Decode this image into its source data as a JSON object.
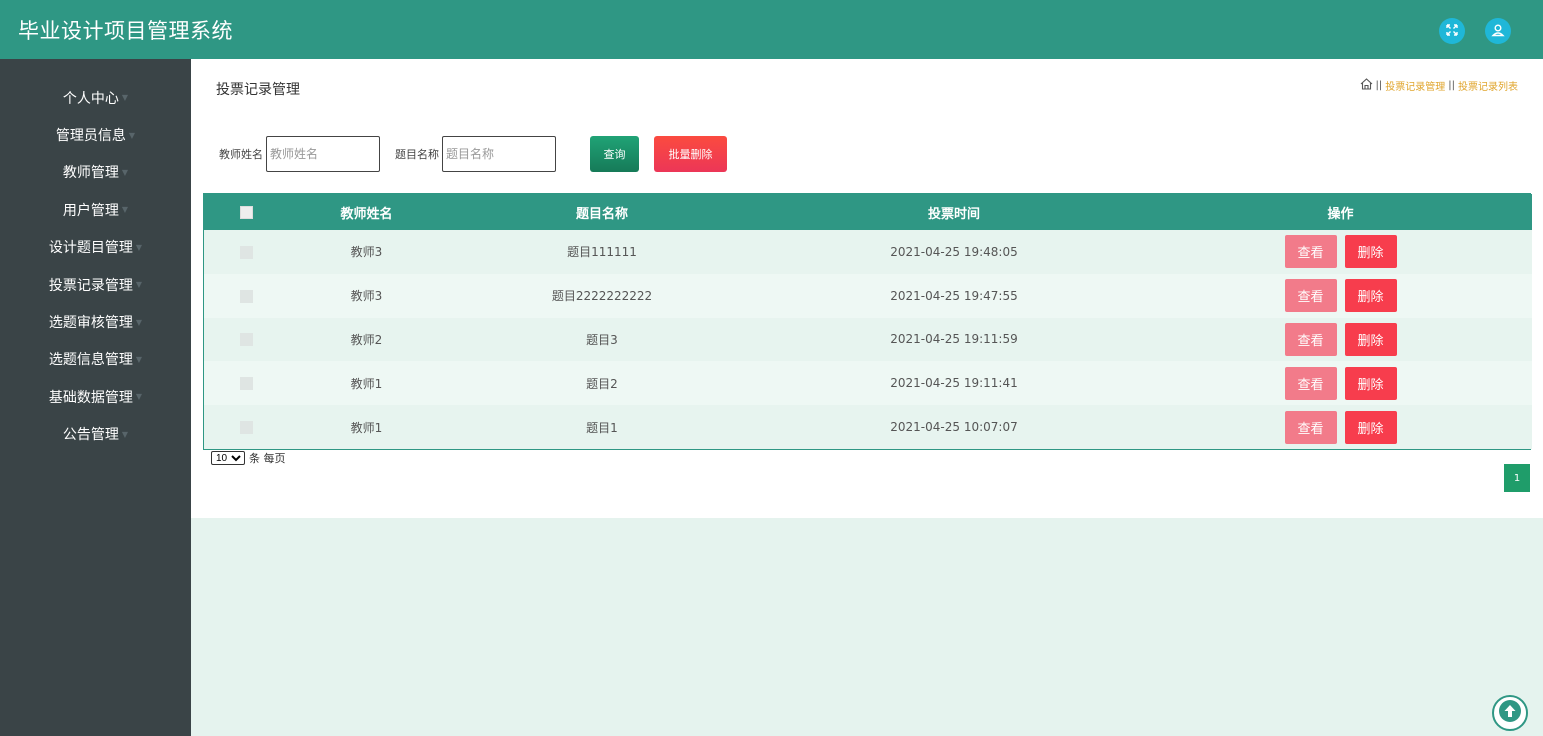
{
  "header": {
    "app_title": "毕业设计项目管理系统",
    "icons": [
      "fullscreen-icon",
      "user-icon"
    ],
    "accent": "#2f9784"
  },
  "sidebar": {
    "items": [
      {
        "label": "个人中心"
      },
      {
        "label": "管理员信息"
      },
      {
        "label": "教师管理"
      },
      {
        "label": "用户管理"
      },
      {
        "label": "设计题目管理"
      },
      {
        "label": "投票记录管理"
      },
      {
        "label": "选题审核管理"
      },
      {
        "label": "选题信息管理"
      },
      {
        "label": "基础数据管理"
      },
      {
        "label": "公告管理"
      }
    ]
  },
  "main": {
    "page_title": "投票记录管理",
    "breadcrumb": {
      "sep": "||",
      "items": [
        "投票记录管理",
        "投票记录列表"
      ]
    },
    "search": {
      "teacher_label": "教师姓名",
      "teacher_placeholder": "教师姓名",
      "teacher_value": "",
      "topic_label": "题目名称",
      "topic_placeholder": "题目名称",
      "topic_value": "",
      "query_label": "查询",
      "bulk_delete_label": "批量删除"
    },
    "table": {
      "columns": [
        "教师姓名",
        "题目名称",
        "投票时间",
        "操作"
      ],
      "rows": [
        {
          "teacher": "教师3",
          "topic": "题目111111",
          "time": "2021-04-25 19:48:05"
        },
        {
          "teacher": "教师3",
          "topic": "题目2222222222",
          "time": "2021-04-25 19:47:55"
        },
        {
          "teacher": "教师2",
          "topic": "题目3",
          "time": "2021-04-25 19:11:59"
        },
        {
          "teacher": "教师1",
          "topic": "题目2",
          "time": "2021-04-25 19:11:41"
        },
        {
          "teacher": "教师1",
          "topic": "题目1",
          "time": "2021-04-25 10:07:07"
        }
      ],
      "view_label": "查看",
      "delete_label": "删除"
    },
    "pager": {
      "page_size": "10",
      "page_size_suffix": "条 每页",
      "current_page": "1"
    }
  }
}
